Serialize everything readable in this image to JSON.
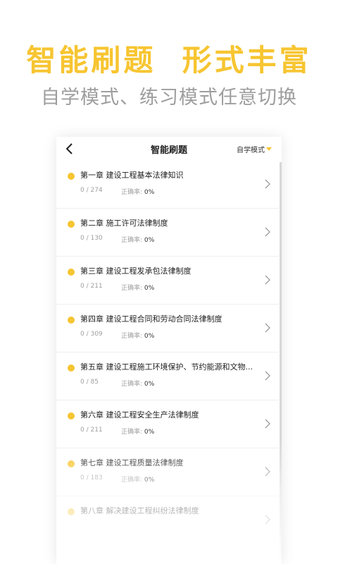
{
  "hero": {
    "title": "智能刷题  形式丰富",
    "subtitle": "自学模式、练习模式任意切换"
  },
  "navbar": {
    "back_icon": "chevron-left-icon",
    "title": "智能刷题",
    "mode_label": "自学模式"
  },
  "accent_color": "#f7c531",
  "chapters": [
    {
      "title": "第一章 建设工程基本法律知识",
      "count": "0 / 274",
      "accuracy_label": "正确率:",
      "accuracy_value": "0%"
    },
    {
      "title": "第二章 施工许可法律制度",
      "count": "0 / 130",
      "accuracy_label": "正确率:",
      "accuracy_value": "0%"
    },
    {
      "title": "第三章 建设工程发承包法律制度",
      "count": "0 / 211",
      "accuracy_label": "正确率:",
      "accuracy_value": "0%"
    },
    {
      "title": "第四章 建设工程合同和劳动合同法律制度",
      "count": "0 / 309",
      "accuracy_label": "正确率:",
      "accuracy_value": "0%"
    },
    {
      "title": "第五章 建设工程施工环境保护、节约能源和文物...",
      "count": "0 / 85",
      "accuracy_label": "正确率:",
      "accuracy_value": "0%"
    },
    {
      "title": "第六章 建设工程安全生产法律制度",
      "count": "0 / 211",
      "accuracy_label": "正确率:",
      "accuracy_value": "0%"
    },
    {
      "title": "第七章 建设工程质量法律制度",
      "count": "0 / 183",
      "accuracy_label": "正确率:",
      "accuracy_value": "0%"
    },
    {
      "title": "第八章 解决建设工程纠纷法律制度",
      "count": "",
      "accuracy_label": "",
      "accuracy_value": ""
    }
  ]
}
